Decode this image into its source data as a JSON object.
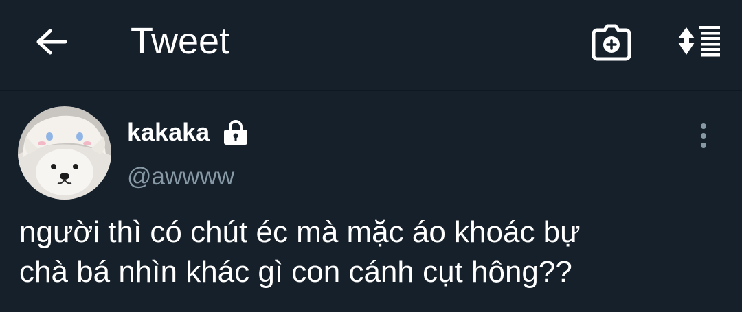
{
  "header": {
    "title": "Tweet",
    "back_icon": "arrow-left-icon",
    "actions": [
      "add-photo-icon",
      "sort-replies-icon"
    ]
  },
  "tweet": {
    "author": {
      "display_name": "kakaka",
      "handle": "@awwww",
      "protected": true,
      "avatar": "white-dog-wearing-towel-hat"
    },
    "text": "người thì có chút éc mà mặc áo khoác bự\nchà bá nhìn khác gì con cánh cụt hông??"
  },
  "colors": {
    "background": "#15202b",
    "primary_text": "#ffffff",
    "secondary_text": "#8899a6"
  }
}
